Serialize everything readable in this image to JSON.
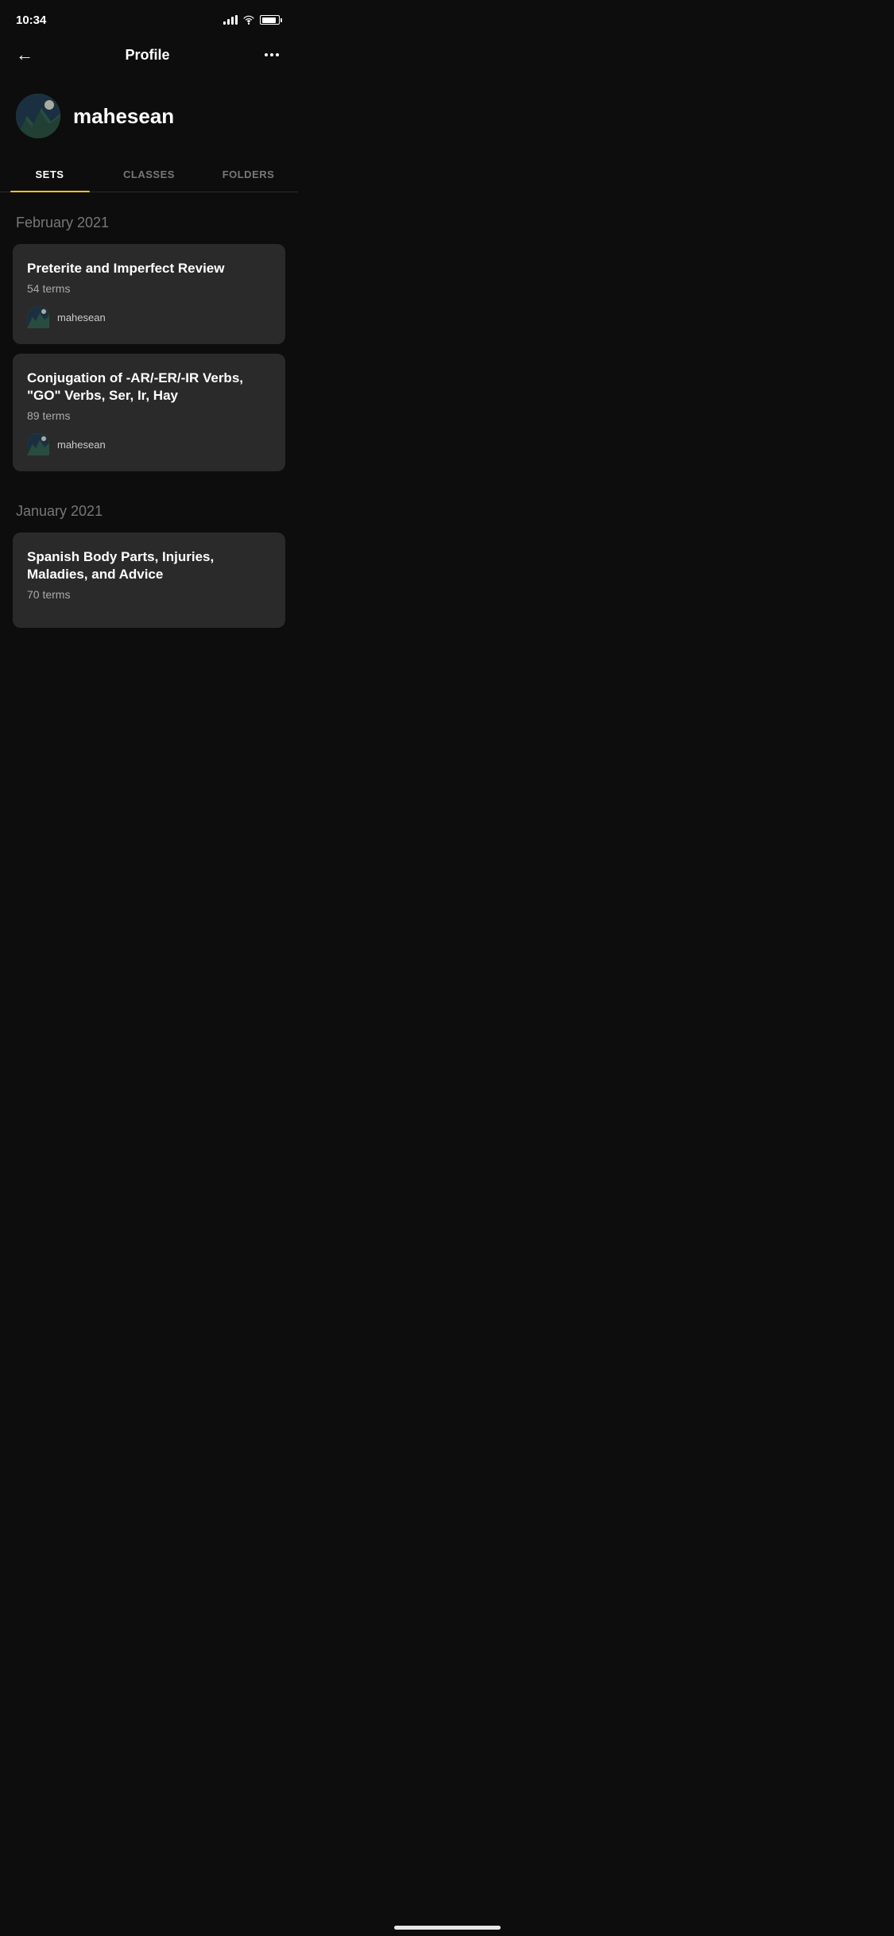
{
  "statusBar": {
    "time": "10:34"
  },
  "header": {
    "title": "Profile",
    "backLabel": "←",
    "moreLabel": "···"
  },
  "profile": {
    "username": "mahesean"
  },
  "tabs": [
    {
      "id": "sets",
      "label": "SETS",
      "active": true
    },
    {
      "id": "classes",
      "label": "CLASSES",
      "active": false
    },
    {
      "id": "folders",
      "label": "FOLDERS",
      "active": false
    }
  ],
  "sections": [
    {
      "month": "February 2021",
      "sets": [
        {
          "title": "Preterite and Imperfect Review",
          "terms": "54 terms",
          "author": "mahesean"
        },
        {
          "title": "Conjugation of -AR/-ER/-IR Verbs, \"GO\" Verbs, Ser, Ir, Hay",
          "terms": "89 terms",
          "author": "mahesean"
        }
      ]
    },
    {
      "month": "January 2021",
      "sets": [
        {
          "title": "Spanish Body Parts, Injuries, Maladies, and Advice",
          "terms": "70 terms",
          "author": ""
        }
      ]
    }
  ],
  "colors": {
    "accent": "#f5c518",
    "background": "#0d0d0d",
    "card": "#2a2a2a",
    "activeTab": "#ffffff",
    "inactiveTab": "#777777"
  }
}
